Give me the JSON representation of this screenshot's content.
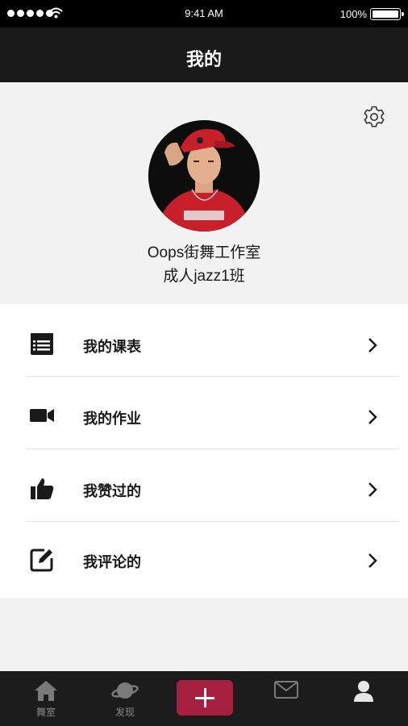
{
  "status_bar": {
    "time": "9:41 AM",
    "battery": "100%"
  },
  "nav": {
    "title": "我的"
  },
  "profile": {
    "studio_name": "Oops街舞工作室",
    "class_name": "成人jazz1班",
    "settings_icon": "gear-icon"
  },
  "menu": {
    "items": [
      {
        "label": "我的课表",
        "icon": "schedule-list-icon"
      },
      {
        "label": "我的作业",
        "icon": "video-camera-icon"
      },
      {
        "label": "我赞过的",
        "icon": "thumbs-up-icon"
      },
      {
        "label": "我评论的",
        "icon": "edit-note-icon"
      }
    ]
  },
  "tab_bar": {
    "tabs": [
      {
        "label": "舞室",
        "icon": "home-icon"
      },
      {
        "label": "发现",
        "icon": "planet-icon"
      },
      {
        "label": "",
        "icon": "plus-icon"
      },
      {
        "label": "",
        "icon": "message-icon"
      },
      {
        "label": "",
        "icon": "profile-icon"
      }
    ]
  },
  "colors": {
    "accent": "#a61f3e",
    "nav_bg": "#1a1a1a",
    "tab_bg": "#1c1c1c"
  }
}
